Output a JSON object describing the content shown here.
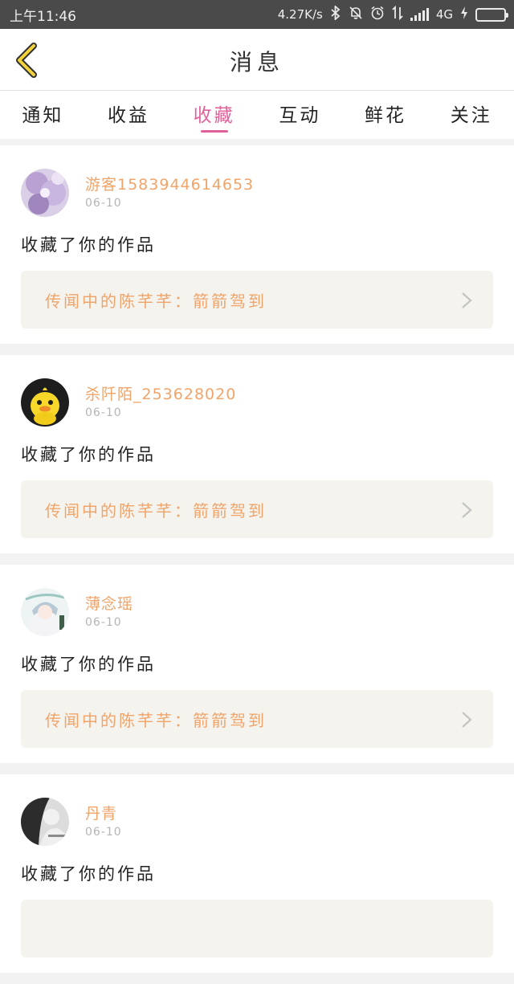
{
  "status_bar": {
    "time": "上午11:46",
    "net_speed": "4.27K/s",
    "network": "4G"
  },
  "nav": {
    "title": "消息"
  },
  "tabs": [
    {
      "label": "通知",
      "active": false
    },
    {
      "label": "收益",
      "active": false
    },
    {
      "label": "收藏",
      "active": true
    },
    {
      "label": "互动",
      "active": false
    },
    {
      "label": "鲜花",
      "active": false
    },
    {
      "label": "关注",
      "active": false
    }
  ],
  "messages": [
    {
      "username": "游客1583944614653",
      "date": "06-10",
      "action": "收藏了你的作品",
      "work": "传闻中的陈芊芊：箭箭驾到",
      "avatar": "purple-flower-avatar"
    },
    {
      "username": "杀阡陌_253628020",
      "date": "06-10",
      "action": "收藏了你的作品",
      "work": "传闻中的陈芊芊：箭箭驾到",
      "avatar": "yellow-duck-avatar"
    },
    {
      "username": "薄念瑶",
      "date": "06-10",
      "action": "收藏了你的作品",
      "work": "传闻中的陈芊芊：箭箭驾到",
      "avatar": "anime-girl-avatar"
    },
    {
      "username": "丹青",
      "date": "06-10",
      "action": "收藏了你的作品",
      "work": "",
      "avatar": "grey-photo-avatar"
    }
  ],
  "colors": {
    "accent_pink": "#e0609a",
    "name_orange": "#f0a46a",
    "back_arrow_yellow": "#f3d33c"
  }
}
